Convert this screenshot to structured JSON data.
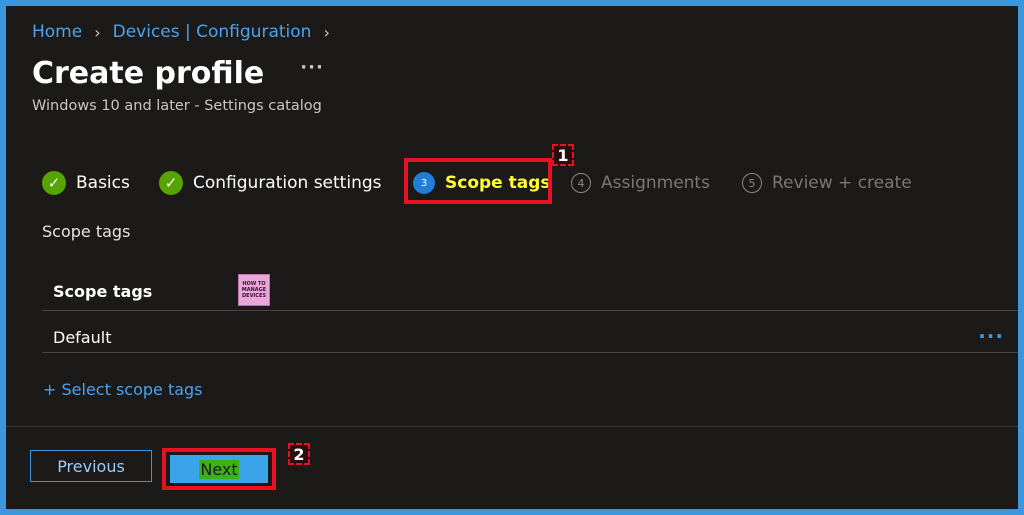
{
  "breadcrumb": {
    "home": "Home",
    "devices": "Devices | Configuration"
  },
  "page": {
    "title": "Create profile",
    "more": "···",
    "subtitle": "Windows 10 and later - Settings catalog"
  },
  "steps": [
    {
      "label": "Basics",
      "status": "complete"
    },
    {
      "label": "Configuration settings",
      "status": "complete"
    },
    {
      "number": "3",
      "label": "Scope tags",
      "status": "active"
    },
    {
      "number": "4",
      "label": "Assignments",
      "status": "upcoming"
    },
    {
      "number": "5",
      "label": "Review + create",
      "status": "upcoming"
    }
  ],
  "annotations": {
    "badge1": "1",
    "badge2": "2"
  },
  "section": {
    "label": "Scope tags"
  },
  "table": {
    "header": "Scope tags",
    "rows": [
      {
        "name": "Default",
        "more": "···"
      }
    ]
  },
  "logo": {
    "line1": "HOW TO",
    "line2": "MANAGE",
    "line3": "DEVICES"
  },
  "select_link": "+ Select scope tags",
  "footer": {
    "previous": "Previous",
    "next": "Next"
  },
  "colors": {
    "accent": "#3a96dd",
    "highlight": "#e81123",
    "active_step": "#ffff33",
    "success": "#57a300"
  }
}
